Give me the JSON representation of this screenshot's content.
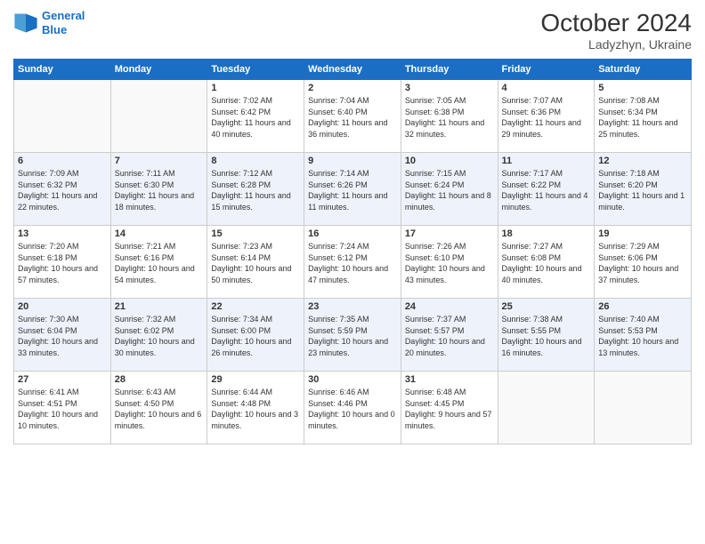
{
  "header": {
    "logo_line1": "General",
    "logo_line2": "Blue",
    "month": "October 2024",
    "location": "Ladyzhyn, Ukraine"
  },
  "weekdays": [
    "Sunday",
    "Monday",
    "Tuesday",
    "Wednesday",
    "Thursday",
    "Friday",
    "Saturday"
  ],
  "weeks": [
    [
      {
        "day": "",
        "info": ""
      },
      {
        "day": "",
        "info": ""
      },
      {
        "day": "1",
        "info": "Sunrise: 7:02 AM\nSunset: 6:42 PM\nDaylight: 11 hours and 40 minutes."
      },
      {
        "day": "2",
        "info": "Sunrise: 7:04 AM\nSunset: 6:40 PM\nDaylight: 11 hours and 36 minutes."
      },
      {
        "day": "3",
        "info": "Sunrise: 7:05 AM\nSunset: 6:38 PM\nDaylight: 11 hours and 32 minutes."
      },
      {
        "day": "4",
        "info": "Sunrise: 7:07 AM\nSunset: 6:36 PM\nDaylight: 11 hours and 29 minutes."
      },
      {
        "day": "5",
        "info": "Sunrise: 7:08 AM\nSunset: 6:34 PM\nDaylight: 11 hours and 25 minutes."
      }
    ],
    [
      {
        "day": "6",
        "info": "Sunrise: 7:09 AM\nSunset: 6:32 PM\nDaylight: 11 hours and 22 minutes."
      },
      {
        "day": "7",
        "info": "Sunrise: 7:11 AM\nSunset: 6:30 PM\nDaylight: 11 hours and 18 minutes."
      },
      {
        "day": "8",
        "info": "Sunrise: 7:12 AM\nSunset: 6:28 PM\nDaylight: 11 hours and 15 minutes."
      },
      {
        "day": "9",
        "info": "Sunrise: 7:14 AM\nSunset: 6:26 PM\nDaylight: 11 hours and 11 minutes."
      },
      {
        "day": "10",
        "info": "Sunrise: 7:15 AM\nSunset: 6:24 PM\nDaylight: 11 hours and 8 minutes."
      },
      {
        "day": "11",
        "info": "Sunrise: 7:17 AM\nSunset: 6:22 PM\nDaylight: 11 hours and 4 minutes."
      },
      {
        "day": "12",
        "info": "Sunrise: 7:18 AM\nSunset: 6:20 PM\nDaylight: 11 hours and 1 minute."
      }
    ],
    [
      {
        "day": "13",
        "info": "Sunrise: 7:20 AM\nSunset: 6:18 PM\nDaylight: 10 hours and 57 minutes."
      },
      {
        "day": "14",
        "info": "Sunrise: 7:21 AM\nSunset: 6:16 PM\nDaylight: 10 hours and 54 minutes."
      },
      {
        "day": "15",
        "info": "Sunrise: 7:23 AM\nSunset: 6:14 PM\nDaylight: 10 hours and 50 minutes."
      },
      {
        "day": "16",
        "info": "Sunrise: 7:24 AM\nSunset: 6:12 PM\nDaylight: 10 hours and 47 minutes."
      },
      {
        "day": "17",
        "info": "Sunrise: 7:26 AM\nSunset: 6:10 PM\nDaylight: 10 hours and 43 minutes."
      },
      {
        "day": "18",
        "info": "Sunrise: 7:27 AM\nSunset: 6:08 PM\nDaylight: 10 hours and 40 minutes."
      },
      {
        "day": "19",
        "info": "Sunrise: 7:29 AM\nSunset: 6:06 PM\nDaylight: 10 hours and 37 minutes."
      }
    ],
    [
      {
        "day": "20",
        "info": "Sunrise: 7:30 AM\nSunset: 6:04 PM\nDaylight: 10 hours and 33 minutes."
      },
      {
        "day": "21",
        "info": "Sunrise: 7:32 AM\nSunset: 6:02 PM\nDaylight: 10 hours and 30 minutes."
      },
      {
        "day": "22",
        "info": "Sunrise: 7:34 AM\nSunset: 6:00 PM\nDaylight: 10 hours and 26 minutes."
      },
      {
        "day": "23",
        "info": "Sunrise: 7:35 AM\nSunset: 5:59 PM\nDaylight: 10 hours and 23 minutes."
      },
      {
        "day": "24",
        "info": "Sunrise: 7:37 AM\nSunset: 5:57 PM\nDaylight: 10 hours and 20 minutes."
      },
      {
        "day": "25",
        "info": "Sunrise: 7:38 AM\nSunset: 5:55 PM\nDaylight: 10 hours and 16 minutes."
      },
      {
        "day": "26",
        "info": "Sunrise: 7:40 AM\nSunset: 5:53 PM\nDaylight: 10 hours and 13 minutes."
      }
    ],
    [
      {
        "day": "27",
        "info": "Sunrise: 6:41 AM\nSunset: 4:51 PM\nDaylight: 10 hours and 10 minutes."
      },
      {
        "day": "28",
        "info": "Sunrise: 6:43 AM\nSunset: 4:50 PM\nDaylight: 10 hours and 6 minutes."
      },
      {
        "day": "29",
        "info": "Sunrise: 6:44 AM\nSunset: 4:48 PM\nDaylight: 10 hours and 3 minutes."
      },
      {
        "day": "30",
        "info": "Sunrise: 6:46 AM\nSunset: 4:46 PM\nDaylight: 10 hours and 0 minutes."
      },
      {
        "day": "31",
        "info": "Sunrise: 6:48 AM\nSunset: 4:45 PM\nDaylight: 9 hours and 57 minutes."
      },
      {
        "day": "",
        "info": ""
      },
      {
        "day": "",
        "info": ""
      }
    ]
  ]
}
